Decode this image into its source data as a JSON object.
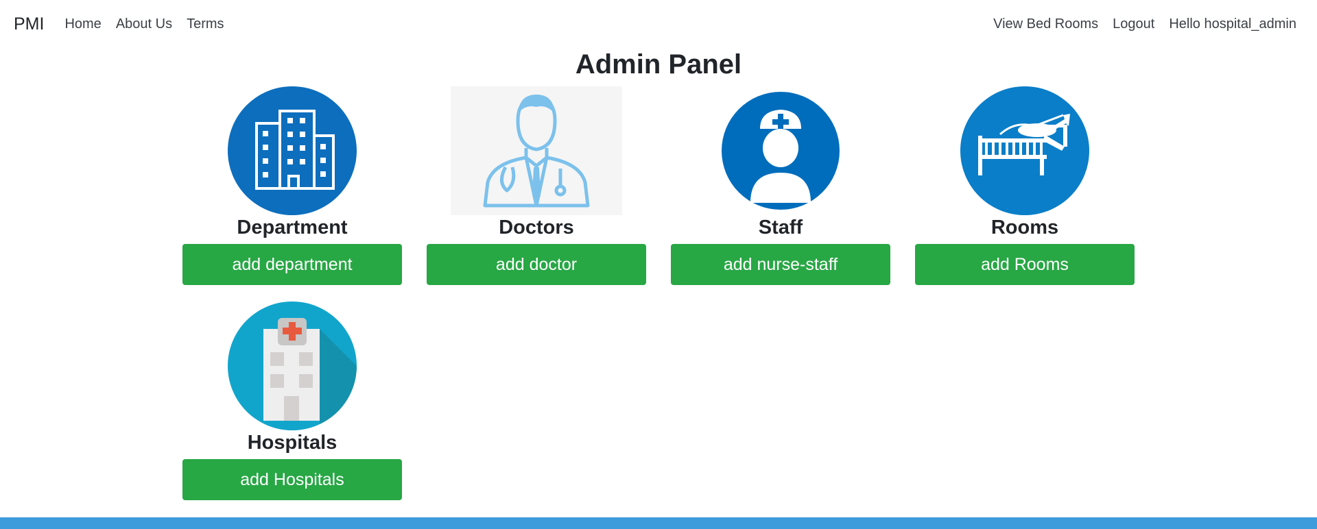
{
  "navbar": {
    "brand": "PMI",
    "left_links": [
      {
        "label": "Home"
      },
      {
        "label": "About Us"
      },
      {
        "label": "Terms"
      }
    ],
    "right_links": [
      {
        "label": "View Bed Rooms"
      },
      {
        "label": "Logout"
      },
      {
        "label": "Hello hospital_admin"
      }
    ]
  },
  "main": {
    "title": "Admin Panel",
    "cards": [
      {
        "title": "Department",
        "button_label": "add department",
        "icon": "building-icon",
        "color": "#0d6ebd"
      },
      {
        "title": "Doctors",
        "button_label": "add doctor",
        "icon": "doctor-icon",
        "color": "#7cc1ec"
      },
      {
        "title": "Staff",
        "button_label": "add nurse-staff",
        "icon": "nurse-icon",
        "color": "#006dbc"
      },
      {
        "title": "Rooms",
        "button_label": "add Rooms",
        "icon": "bed-icon",
        "color": "#0a7ec8"
      },
      {
        "title": "Hospitals",
        "button_label": "add Hospitals",
        "icon": "hospital-icon",
        "color": "#12a5cc"
      }
    ]
  },
  "colors": {
    "button": "#28a745",
    "footer": "#3d9cdc"
  }
}
